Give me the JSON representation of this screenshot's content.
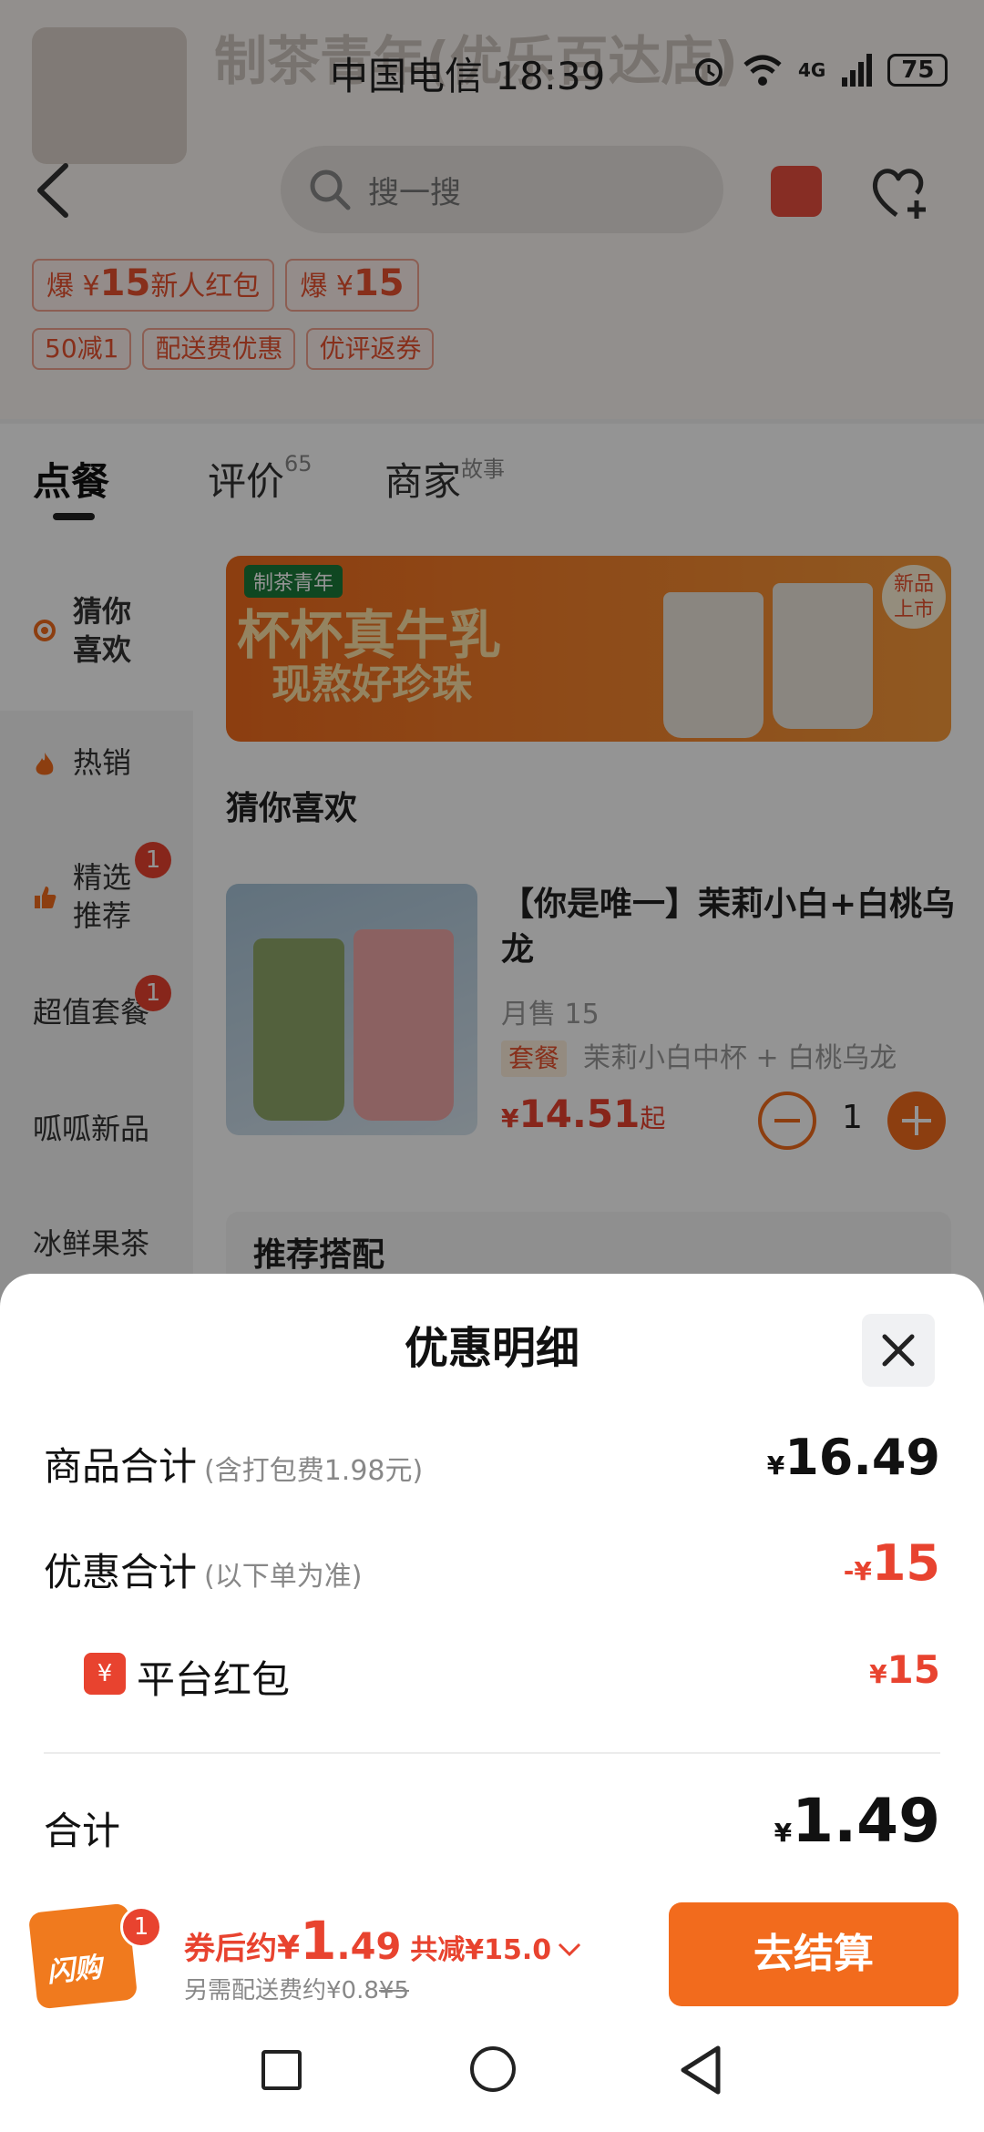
{
  "status_bar": {
    "carrier_time": "中国电信 18:39",
    "network": "4G",
    "battery": "75"
  },
  "shop": {
    "title": "制茶青年(优乐百达店)",
    "search_placeholder": "搜一搜",
    "coupons_main": [
      {
        "prefix": "爆",
        "currency": "¥",
        "amount": "15",
        "suffix": "新人红包"
      },
      {
        "prefix": "爆",
        "currency": "¥",
        "amount": "15",
        "suffix": ""
      }
    ],
    "coupons_small": [
      "50减1",
      "配送费优惠",
      "优评返券"
    ]
  },
  "tabs": [
    {
      "label": "点餐",
      "sup": ""
    },
    {
      "label": "评价",
      "sup": "65"
    },
    {
      "label": "商家",
      "sup": "故事"
    }
  ],
  "left_nav": {
    "items": [
      {
        "label1": "猜你",
        "label2": "喜欢"
      },
      {
        "label1": "热销",
        "label2": ""
      },
      {
        "label1": "精选",
        "label2": "推荐",
        "badge": "1"
      },
      {
        "label1": "超值套餐",
        "label2": "",
        "badge": "1"
      },
      {
        "label1": "呱呱新品",
        "label2": ""
      },
      {
        "label1": "冰鲜果茶",
        "label2": ""
      }
    ]
  },
  "banner": {
    "brand": "制茶青年",
    "line1": "杯杯真牛乳",
    "line2": "现熬好珍珠",
    "new_tag1": "新品",
    "new_tag2": "上市"
  },
  "section_title": "猜你喜欢",
  "product": {
    "name": "【你是唯一】茉莉小白+白桃乌龙",
    "sales": "月售 15",
    "combo_tag": "套餐",
    "combo_desc": "茉莉小白中杯 + 白桃乌龙",
    "price_currency": "¥",
    "price": "14.51",
    "price_suffix": "起",
    "quantity": "1"
  },
  "recommend_title": "推荐搭配",
  "sheet": {
    "title": "优惠明细",
    "goods_total_label": "商品合计",
    "goods_total_sub": "(含打包费1.98元)",
    "goods_total_currency": "¥",
    "goods_total_value": "16.49",
    "discount_label": "优惠合计",
    "discount_sub": "(以下单为准)",
    "discount_prefix": "-¥",
    "discount_value": "15",
    "platform_icon": "¥",
    "platform_label": "平台红包",
    "platform_currency": "¥",
    "platform_value": "15",
    "total_label": "合计",
    "total_currency": "¥",
    "total_value": "1.49"
  },
  "bottom_bar": {
    "bag_label": "闪购",
    "bag_badge": "1",
    "after_coupon_label": "券后约",
    "currency": "¥",
    "price_int": "1",
    "price_dec": ".49",
    "saved": "共减¥15.0",
    "delivery_text": "另需配送费约¥0.8",
    "delivery_original": "¥5",
    "checkout_label": "去结算"
  },
  "colors": {
    "accent": "#f26b1d",
    "red": "#e8432f"
  }
}
